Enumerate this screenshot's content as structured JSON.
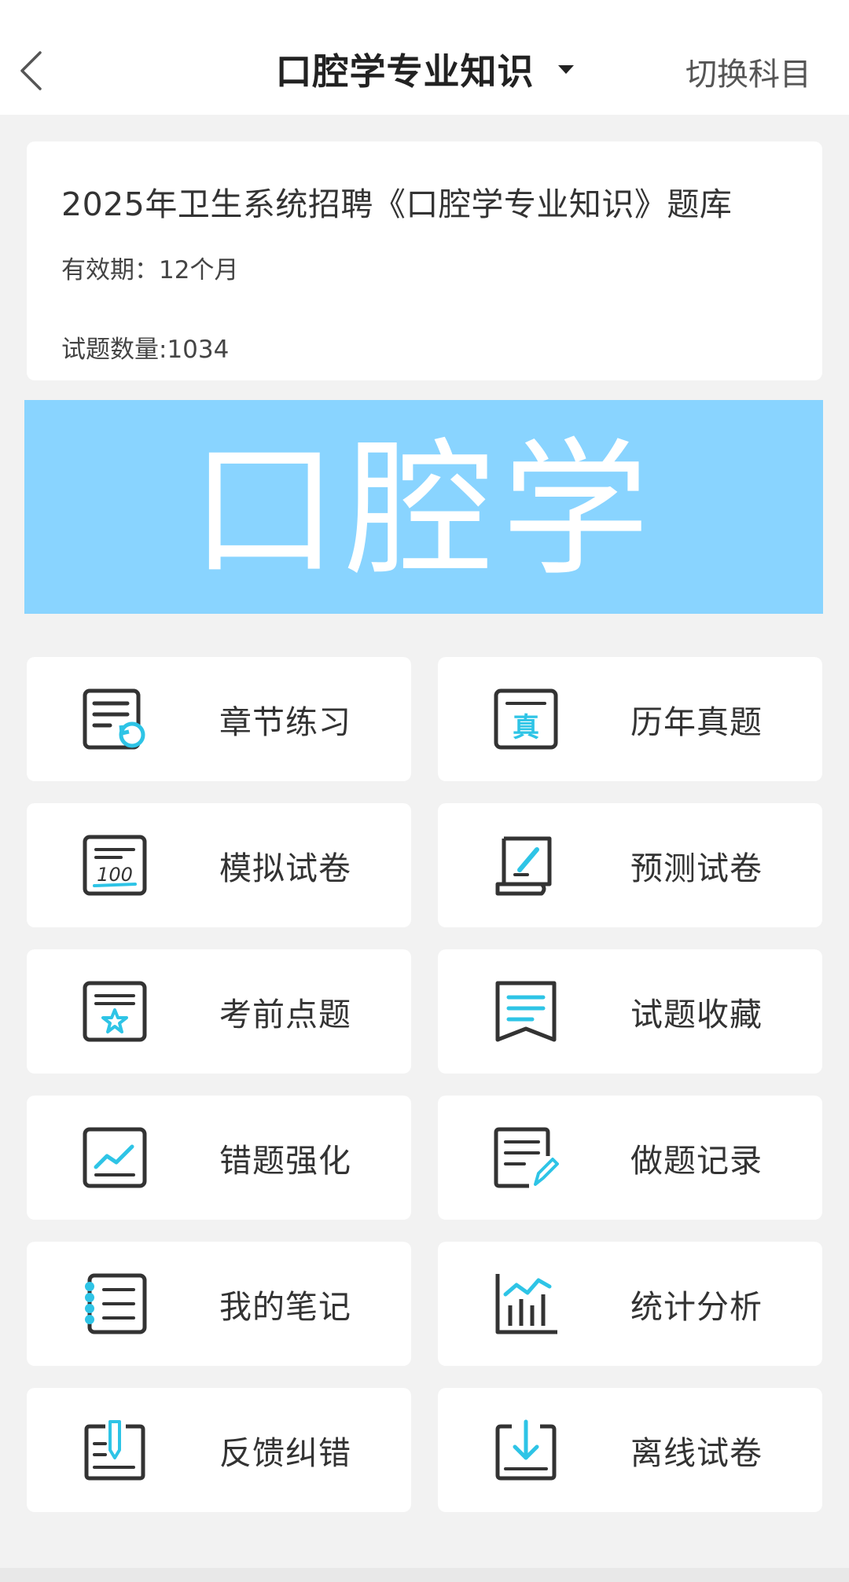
{
  "header": {
    "title": "口腔学专业知识",
    "switch_label": "切换科目"
  },
  "info": {
    "bank_title": "2025年卫生系统招聘《口腔学专业知识》题库",
    "validity": "有效期：12个月",
    "question_count": "试题数量:1034"
  },
  "banner": {
    "text": "口腔学",
    "color": "#89d4ff"
  },
  "colors": {
    "accent": "#2ec4e6",
    "icon_dark": "#333333"
  },
  "menu": [
    {
      "label": "章节练习",
      "icon": "chapter-practice-icon"
    },
    {
      "label": "历年真题",
      "icon": "past-exams-icon"
    },
    {
      "label": "模拟试卷",
      "icon": "mock-paper-icon"
    },
    {
      "label": "预测试卷",
      "icon": "forecast-paper-icon"
    },
    {
      "label": "考前点题",
      "icon": "key-points-icon"
    },
    {
      "label": "试题收藏",
      "icon": "favorites-icon"
    },
    {
      "label": "错题强化",
      "icon": "wrong-questions-icon"
    },
    {
      "label": "做题记录",
      "icon": "practice-record-icon"
    },
    {
      "label": "我的笔记",
      "icon": "notes-icon"
    },
    {
      "label": "统计分析",
      "icon": "statistics-icon"
    },
    {
      "label": "反馈纠错",
      "icon": "feedback-icon"
    },
    {
      "label": "离线试卷",
      "icon": "offline-paper-icon"
    }
  ]
}
